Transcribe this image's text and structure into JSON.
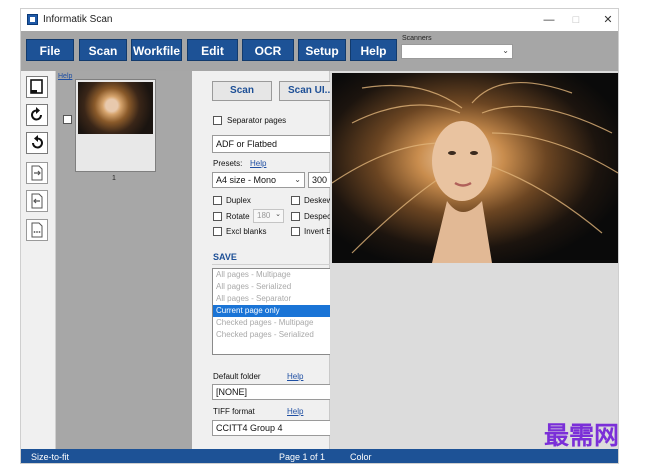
{
  "window": {
    "title": "Informatik Scan"
  },
  "menu": {
    "items": [
      "File",
      "Scan",
      "Workfile",
      "Edit",
      "OCR",
      "Setup",
      "Help"
    ]
  },
  "scanners": {
    "label": "Scanners",
    "value": ""
  },
  "thumbs": {
    "help_label": "Help",
    "page_number": "1"
  },
  "controls": {
    "scan_label": "Scan",
    "scan_ui_label": "Scan UI...",
    "separator_pages_label": "Separator pages",
    "source_value": "ADF or Flatbed",
    "presets_label": "Presets:",
    "presets_help": "Help",
    "preset_value": "A4 size - Mono",
    "dpi_value": "300",
    "duplex_label": "Duplex",
    "deskew_label": "Deskew",
    "rotate_label": "Rotate",
    "rotate_value": "180",
    "despeckle_label": "Despeckle",
    "excl_blanks_label": "Excl blanks",
    "invert_bw_label": "Invert BW"
  },
  "save": {
    "header": "SAVE",
    "options": [
      "All pages - Multipage",
      "All pages - Serialized",
      "All pages - Separator",
      "Current page only",
      "Checked pages - Multipage",
      "Checked pages - Serialized"
    ],
    "default_folder_label": "Default folder",
    "default_folder_help": "Help",
    "default_folder_value": "[NONE]",
    "tiff_format_label": "TIFF format",
    "tiff_format_help": "Help",
    "tiff_format_value": "CCITT4 Group 4"
  },
  "status": {
    "left": "Size-to-fit",
    "page": "Page 1 of 1",
    "mode": "Color"
  },
  "watermark": "最需网",
  "colors": {
    "accent": "#1d5296",
    "selection": "#1a74d6",
    "watermark": "#7b2fd8"
  }
}
